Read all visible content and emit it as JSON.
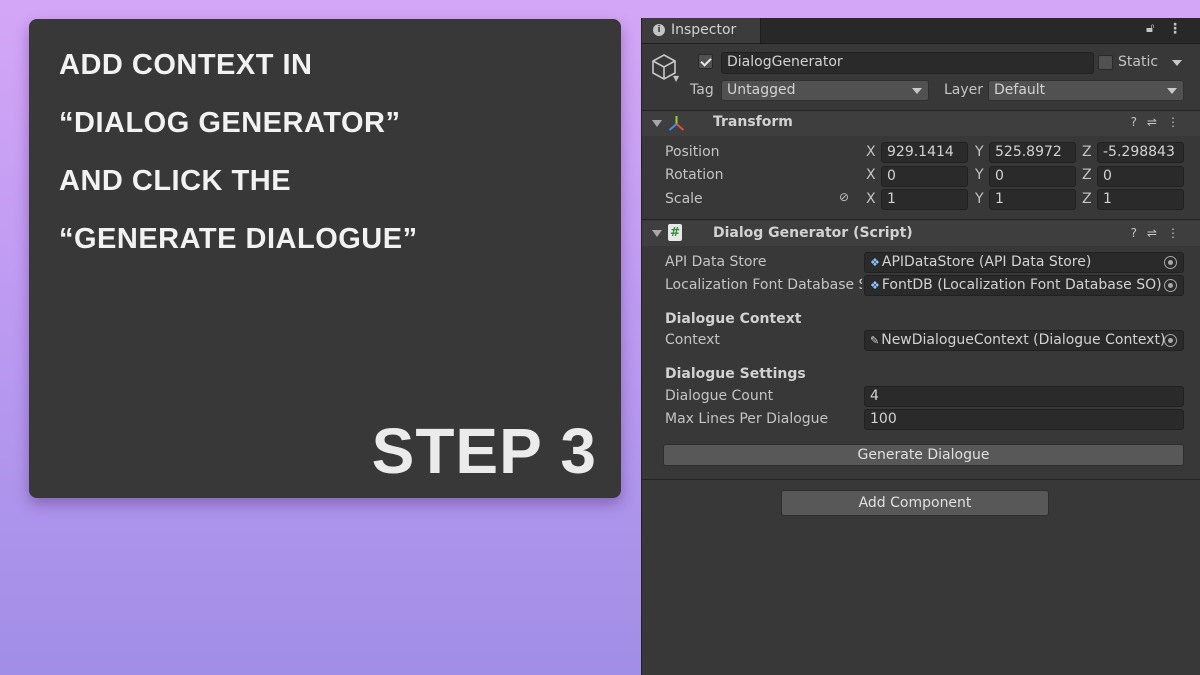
{
  "instructions": {
    "lines": [
      "ADD CONTEXT IN",
      "“DIALOG GENERATOR”",
      "AND CLICK THE",
      "“GENERATE DIALOGUE”"
    ],
    "step": "STEP 3"
  },
  "inspector": {
    "tab": {
      "label": "Inspector",
      "icon": "info-icon"
    },
    "object": {
      "name": "DialogGenerator",
      "active": true,
      "static_label": "Static",
      "static": false,
      "tag_label": "Tag",
      "tag_value": "Untagged",
      "layer_label": "Layer",
      "layer_value": "Default"
    },
    "transform": {
      "title": "Transform",
      "rows": [
        {
          "label": "Position",
          "x": "929.1414",
          "y": "525.8972",
          "z": "-5.298843"
        },
        {
          "label": "Rotation",
          "x": "0",
          "y": "0",
          "z": "0"
        },
        {
          "label": "Scale",
          "x": "1",
          "y": "1",
          "z": "1"
        }
      ],
      "axis": {
        "x": "X",
        "y": "Y",
        "z": "Z"
      }
    },
    "script": {
      "title": "Dialog Generator (Script)",
      "api_label": "API Data Store",
      "api_value": "APIDataStore (API Data Store)",
      "font_label": "Localization Font Database S",
      "font_value": "FontDB (Localization Font Database SO)",
      "context_header": "Dialogue Context",
      "context_label": "Context",
      "context_value": "NewDialogueContext (Dialogue Context)",
      "settings_header": "Dialogue Settings",
      "count_label": "Dialogue Count",
      "count_value": "4",
      "maxlines_label": "Max Lines Per Dialogue",
      "maxlines_value": "100",
      "generate_button": "Generate Dialogue"
    },
    "add_component": "Add Component"
  }
}
